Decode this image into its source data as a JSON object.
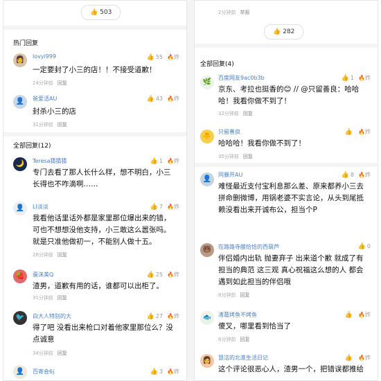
{
  "left": {
    "top_like_count": "503",
    "hot_title": "热门回复",
    "hot": [
      {
        "user": "lovyi999",
        "likes": "55",
        "extra": "炸",
        "text": "一定要封了小三的店！！不接受道歉！",
        "time": "24分钟前",
        "reply": "回复",
        "avatar": "👩"
      },
      {
        "user": "爸爱活AU",
        "likes": "43",
        "extra": "炸",
        "text": "封杀小三的店",
        "time": "31分钟前",
        "reply": "回复",
        "avatar": "👤"
      }
    ],
    "all_title": "全部回复(12)",
    "all": [
      {
        "user": "Teresa猜猜猜",
        "likes": "1",
        "extra": "炸",
        "text": "专门去看了那人长什么样，想不明白，小三长得也不咋滴啊……",
        "time": "",
        "reply": "",
        "avatar": "🌙"
      },
      {
        "user": "LI淡淡",
        "likes": "7",
        "extra": "炸",
        "text": "我看他话里话外都是家里那位爆出来的错，可也不想想没他支持，小三敢这么嚣张吗。就是只准他做初一，不能别人做十五。",
        "time": "28分钟前",
        "reply": "回复",
        "avatar": "👤"
      },
      {
        "user": "蛋沫美Q",
        "likes": "25",
        "extra": "炸",
        "text": "渣男，道歉有用的话，谁都可以出柜了。",
        "time": "31分钟前",
        "reply": "回复",
        "avatar": "🍓"
      },
      {
        "user": "白大人特别的大",
        "likes": "27",
        "extra": "炸",
        "text": "得了吧 没看出来枪口对着他家里那位么？没点诚意",
        "time": "34分钟前",
        "reply": "回复",
        "avatar": "🐦"
      },
      {
        "user": "百寄会6j",
        "likes": "3",
        "extra": "炸",
        "text": "",
        "time": "",
        "reply": "",
        "avatar": "👤"
      }
    ]
  },
  "right": {
    "top_meta_time": "2分钟前",
    "top_meta_reply": "举报",
    "top_like_count": "282",
    "all_title": "全部回复(4)",
    "all": [
      {
        "user": "百度网友9ac0b3b",
        "likes": "1",
        "extra": "炸",
        "text": "京东、考拉也挺香的😊 // @只留善良：哈哈哈！我看你做不到了！",
        "time": "32分钟前",
        "reply": "回复",
        "avatar": "🌿"
      },
      {
        "user": "只留善良",
        "likes": "",
        "extra": "炸",
        "text": "哈哈哈！我看你做不到了！",
        "time": "35分钟前",
        "reply": "回复",
        "avatar": "🐥"
      },
      {
        "user": "同暴开AU",
        "likes": "8",
        "extra": "炸",
        "text": "难怪最近支付宝利息那么差、原来都养小三去拼命删微博，用锅老婆不实言论，从头到尾抵赖没看出来开诚布公，担当个P",
        "time": "",
        "reply": "",
        "avatar": "👤"
      },
      {
        "user": "在路路寺酿恰恰的西葫芦",
        "likes": "0",
        "extra": "",
        "text": "伴侣婚内出轨 抛妻弃子 出来道个歉 就成了有担当的典范 这三观 真心祝福这么想的人 都会遇到如此担当的伴侣哦",
        "time": "8分钟前",
        "reply": "回复",
        "avatar": "🐻"
      },
      {
        "user": "渚葛烤鱼不烤鱼",
        "likes": "",
        "extra": "炸",
        "text": "傻叉，哪里看到恰当了",
        "time": "6分钟前",
        "reply": "回复",
        "avatar": "🐟"
      },
      {
        "user": "慧洁的北淮生活日记",
        "likes": "",
        "extra": "炸",
        "text": "这个评论很恶心人，渣男一个，把错误都推给",
        "time": "",
        "reply": "",
        "avatar": "👩"
      }
    ]
  }
}
